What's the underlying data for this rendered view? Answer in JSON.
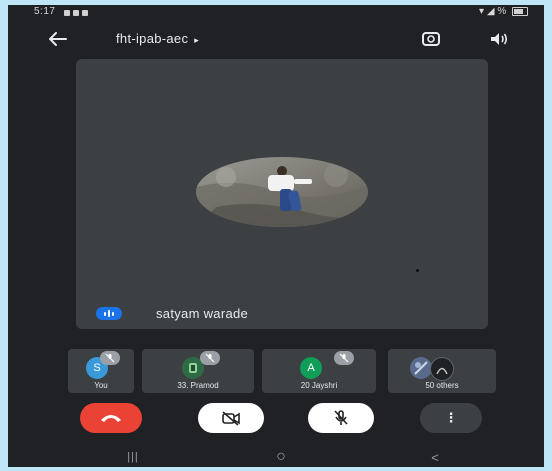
{
  "status_bar": {
    "time": "5:17",
    "signal_text": "%"
  },
  "top_bar": {
    "meeting_code": "fht-ipab-aec",
    "chevron": "▸",
    "back_icon": "arrow-left-icon",
    "switch_camera_icon": "camera-switch-icon",
    "audio_icon": "speaker-icon"
  },
  "main_tile": {
    "speaker_name": "satyam warade",
    "speaking_color": "#1a73e8"
  },
  "participants": [
    {
      "label": "You",
      "initial": "S",
      "avatar_color": "#3a9ad9"
    },
    {
      "label": "33. Pramod",
      "initial": "",
      "avatar_color": "#2e6b45"
    },
    {
      "label": "20 Jayshri",
      "initial": "A",
      "avatar_color": "#0f9d58"
    },
    {
      "label": "50 others",
      "initial": "",
      "avatar_color": "#5a6a8a"
    }
  ],
  "controls": {
    "end_call_color": "#ea4335",
    "more_label": "⋮"
  },
  "nav": {
    "recents": "|||",
    "home": "○",
    "back": "<"
  },
  "colors": {
    "background": "#202124",
    "tile": "#3c4043",
    "frame": "#bfe6f6"
  }
}
